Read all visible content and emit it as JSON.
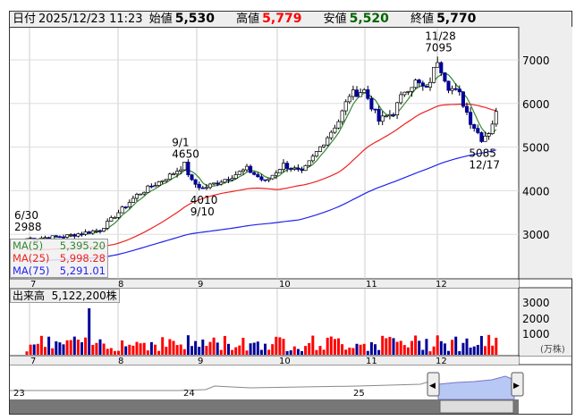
{
  "header": {
    "date_label": "日付",
    "datetime": "2025/12/23 11:23",
    "open_label": "始値",
    "open": "5,530",
    "high_label": "高値",
    "high": "5,779",
    "low_label": "安値",
    "low": "5,520",
    "close_label": "終値",
    "close": "5,770"
  },
  "colors": {
    "up": "#ff0000",
    "down": "#000099",
    "ma5": "#338833",
    "ma25": "#ee2222",
    "ma75": "#2222ee",
    "high": "#ff0000",
    "low": "#006600"
  },
  "legend": [
    {
      "label": "MA(5)",
      "value": "5,395.20"
    },
    {
      "label": "MA(25)",
      "value": "5,998.28"
    },
    {
      "label": "MA(75)",
      "value": "5,291.01"
    }
  ],
  "volume": {
    "label": "出来高",
    "value": "5,122,200株",
    "unit": "(万株)",
    "ticks": [
      "3000",
      "2000",
      "1000"
    ]
  },
  "annotations": [
    {
      "date": "6/30",
      "price": "2988"
    },
    {
      "date": "9/1",
      "price": "4650"
    },
    {
      "date": "9/10",
      "price": "4010"
    },
    {
      "date": "11/28",
      "price": "7095"
    },
    {
      "date": "12/17",
      "price": "5085"
    }
  ],
  "navigator": {
    "years": [
      "23",
      "24",
      "25"
    ]
  },
  "chart_data": {
    "type": "candlestick",
    "price_ticks": [
      7000,
      6000,
      5000,
      4000,
      3000
    ],
    "months": [
      "7",
      "8",
      "9",
      "10",
      "11",
      "12"
    ],
    "close_anchors": [
      [
        0,
        2900
      ],
      [
        10,
        2950
      ],
      [
        20,
        3100
      ],
      [
        25,
        3500
      ],
      [
        30,
        3900
      ],
      [
        40,
        4400
      ],
      [
        43,
        4600
      ],
      [
        45,
        4200
      ],
      [
        48,
        4050
      ],
      [
        55,
        4300
      ],
      [
        60,
        4500
      ],
      [
        65,
        4200
      ],
      [
        70,
        4600
      ],
      [
        75,
        4400
      ],
      [
        80,
        5000
      ],
      [
        85,
        5600
      ],
      [
        88,
        6200
      ],
      [
        92,
        6300
      ],
      [
        96,
        5600
      ],
      [
        100,
        5800
      ],
      [
        103,
        6300
      ],
      [
        106,
        6500
      ],
      [
        109,
        6300
      ],
      [
        112,
        7000
      ],
      [
        115,
        6400
      ],
      [
        118,
        6200
      ],
      [
        121,
        5600
      ],
      [
        124,
        5200
      ],
      [
        126,
        5350
      ],
      [
        128,
        5770
      ]
    ]
  }
}
